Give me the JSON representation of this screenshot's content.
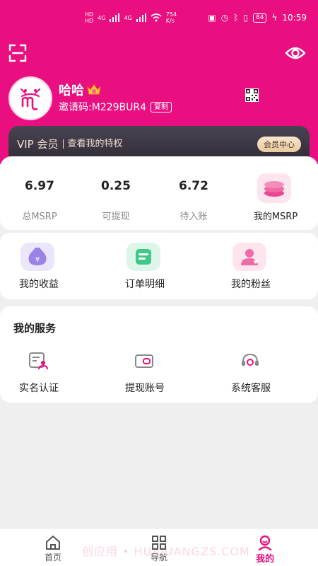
{
  "status_bar": {
    "net_left": [
      "HD",
      "HD"
    ],
    "sig1": "4G",
    "sig2": "4G",
    "speed": "754 K/s",
    "battery": "84",
    "time": "10:59"
  },
  "user": {
    "name": "哈哈",
    "invite_label": "邀请码:",
    "invite_code": "M229BUR4",
    "copy_label": "复制"
  },
  "vip": {
    "title": "VIP 会员",
    "subtitle": "查看我的特权",
    "center_button": "会员中心"
  },
  "stats": [
    {
      "value": "6.97",
      "label": "总MSRP"
    },
    {
      "value": "0.25",
      "label": "可提现"
    },
    {
      "value": "6.72",
      "label": "待入账"
    }
  ],
  "my_msrp_label": "我的MSRP",
  "features": [
    {
      "label": "我的收益",
      "icon": "money-bag-icon",
      "bg": "#ece6fb"
    },
    {
      "label": "订单明细",
      "icon": "card-icon",
      "bg": "#def5ea"
    },
    {
      "label": "我的粉丝",
      "icon": "fans-icon",
      "bg": "#fde4ee"
    }
  ],
  "services": {
    "title": "我的服务",
    "items": [
      {
        "label": "实名认证",
        "icon": "id-verify-icon"
      },
      {
        "label": "提现账号",
        "icon": "wallet-icon"
      },
      {
        "label": "系统客服",
        "icon": "headset-icon"
      }
    ]
  },
  "nav": [
    {
      "label": "首页",
      "icon": "home-icon"
    },
    {
      "label": "导航",
      "icon": "grid-icon"
    },
    {
      "label": "我的",
      "icon": "profile-icon",
      "active": true
    }
  ],
  "watermark": "创应用 • HUAJUANGZS.COM",
  "colors": {
    "brand": "#ea0f80",
    "vip_dark": "#3a3540",
    "vip_gold": "#ede0cf"
  }
}
